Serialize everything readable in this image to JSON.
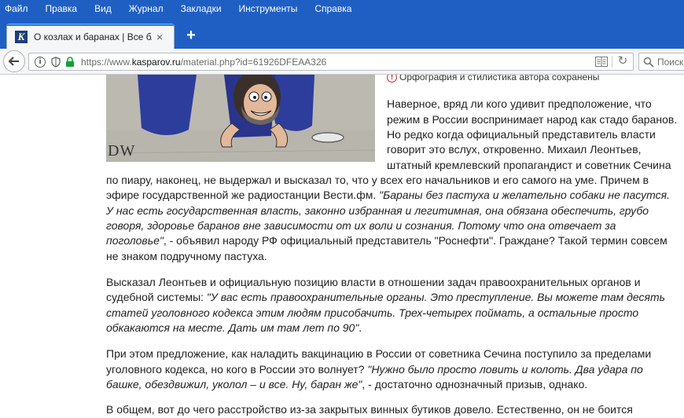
{
  "menu": [
    "Файл",
    "Правка",
    "Вид",
    "Журнал",
    "Закладки",
    "Инструменты",
    "Справка"
  ],
  "tab": {
    "favicon_letter": "K",
    "title": "О козлах и баранах | Все бл...",
    "close": "×"
  },
  "newtab": "+",
  "nav": {
    "url_prefix": "https://www.",
    "url_domain": "kasparov.ru",
    "url_path": "/material.php?id=61926DFEAA326",
    "search_placeholder": "Поиск"
  },
  "article": {
    "cartoon_signature": "DW",
    "note": "Орфография и стилистика автора сохранены",
    "p1": [
      "Наверное, вряд ли кого удивит предположение, что",
      "режим в России воспринимает народ как стадо баранов.",
      "Но редко когда официальный представитель власти",
      "говорит это вслух, откровенно. Михаил Леонтьев,",
      "штатный кремлевский пропагандист и советник Сечина"
    ],
    "p1_full": [
      "по пиару, наконец, не выдержал и высказал то, что у всех его начальников и его самого на уме. Причем в",
      "эфире государственной же радиостанции Вести.фм. "
    ],
    "p1_quote": [
      "\"Бараны без пастуха и желательно собаки не пасутся.",
      "У нас есть государственная власть, законно избранная и легитимная, она обязана обеспечить, грубо",
      "говоря, здоровье баранов вне зависимости от их воли и сознания. Потому что она отвечает за",
      "поголовье\""
    ],
    "p1_tail": [
      ", - объявил народу РФ официальный представитель \"Роснефти\". Граждане? Такой термин совсем",
      "не знаком подручному пастуха."
    ],
    "p2": [
      "Высказал Леонтьев и официальную позицию власти в отношении задач правоохранительных органов и",
      "судебной системы: "
    ],
    "p2_quote": [
      "\"У вас есть правоохранительные органы. Это преступление. Вы можете там десять",
      "статей уголовного кодекса этим людям присобачить. Трех-четырех поймать, а остальные просто",
      "обкакаются на месте. Дать им там лет по 90\""
    ],
    "p2_end": ".",
    "p3": [
      "При этом предложение, как наладить вакцинацию в России от советника Сечина поступило за пределами",
      "уголовного кодекса, но кого в России это волнует? "
    ],
    "p3_quote": [
      "\"Нужно было просто ловить и колоть. Два удара по",
      "башке, обездвижил, уколол – и все. Ну, баран же\""
    ],
    "p3_tail": ", - достаточно однозначный призыв, однако.",
    "p4": "В общем, вот до чего расстройство из-за закрытых винных бутиков довело. Естественно, он не боится"
  }
}
